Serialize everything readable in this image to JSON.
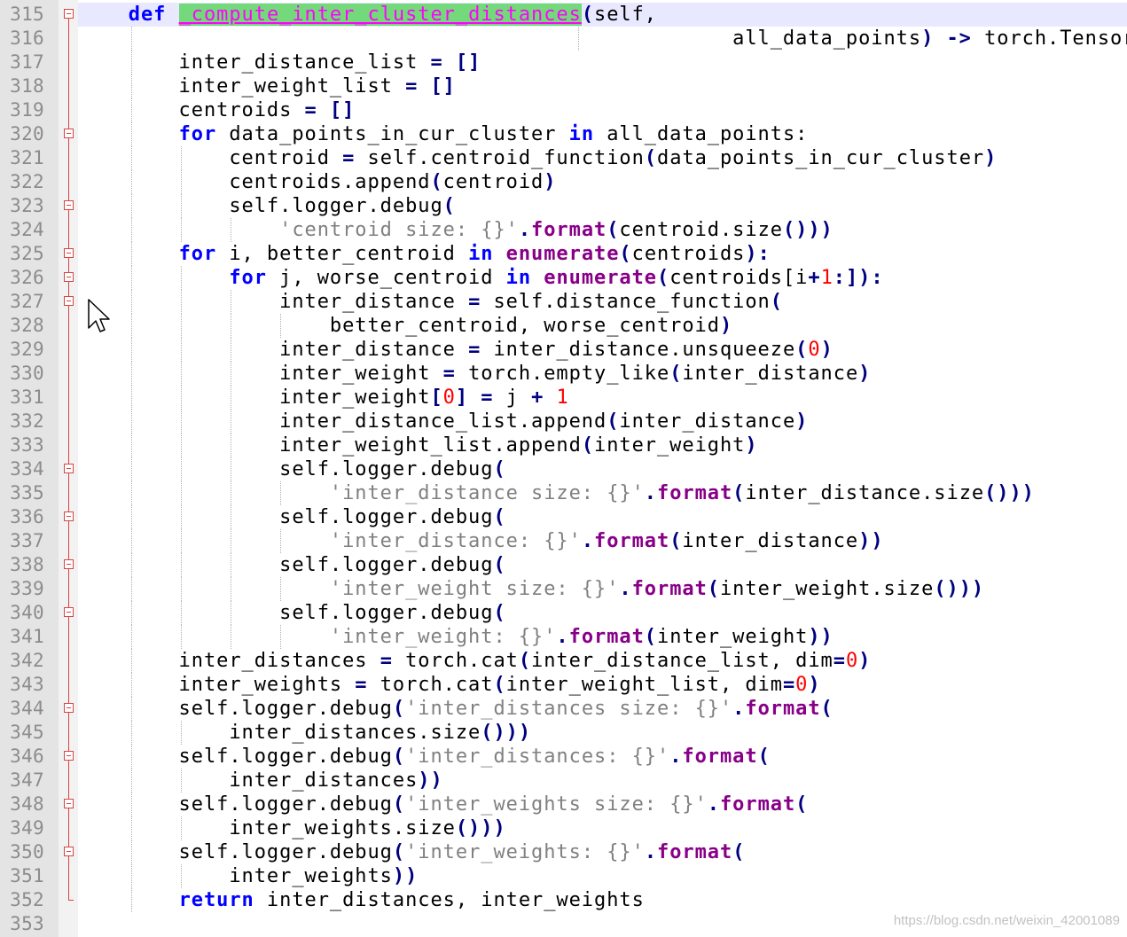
{
  "editor": {
    "lines": [
      {
        "n": "315",
        "fold": "box-first",
        "guides": [],
        "tokens": [
          [
            "",
            "    "
          ],
          [
            "kw",
            "def"
          ],
          [
            "",
            " "
          ],
          [
            "fn-def",
            "_compute_inter_cluster_distances"
          ],
          [
            "op",
            "("
          ],
          [
            "",
            "self,"
          ]
        ],
        "current": true
      },
      {
        "n": "316",
        "fold": "line",
        "guides": [
          148,
          652
        ],
        "tokens": [
          [
            "",
            "                                                    all_data_points"
          ],
          [
            "op",
            ")"
          ],
          [
            "",
            " "
          ],
          [
            "op",
            "->"
          ],
          [
            "",
            " torch.Tensor:"
          ]
        ]
      },
      {
        "n": "317",
        "fold": "line",
        "guides": [
          148
        ],
        "tokens": [
          [
            "",
            "        inter_distance_list "
          ],
          [
            "op",
            "="
          ],
          [
            "",
            " "
          ],
          [
            "op",
            "[]"
          ]
        ]
      },
      {
        "n": "318",
        "fold": "line",
        "guides": [
          148
        ],
        "tokens": [
          [
            "",
            "        inter_weight_list "
          ],
          [
            "op",
            "="
          ],
          [
            "",
            " "
          ],
          [
            "op",
            "[]"
          ]
        ]
      },
      {
        "n": "319",
        "fold": "line",
        "guides": [
          148
        ],
        "tokens": [
          [
            "",
            "        centroids "
          ],
          [
            "op",
            "="
          ],
          [
            "",
            " "
          ],
          [
            "op",
            "[]"
          ]
        ]
      },
      {
        "n": "320",
        "fold": "box",
        "guides": [
          148
        ],
        "tokens": [
          [
            "",
            "        "
          ],
          [
            "kw",
            "for"
          ],
          [
            "",
            " data_points_in_cur_cluster "
          ],
          [
            "kw",
            "in"
          ],
          [
            "",
            " all_data_points:"
          ]
        ]
      },
      {
        "n": "321",
        "fold": "line",
        "guides": [
          148,
          204
        ],
        "tokens": [
          [
            "",
            "            centroid "
          ],
          [
            "op",
            "="
          ],
          [
            "",
            " self.centroid_function"
          ],
          [
            "op",
            "("
          ],
          [
            "",
            "data_points_in_cur_cluster"
          ],
          [
            "op",
            ")"
          ]
        ]
      },
      {
        "n": "322",
        "fold": "line",
        "guides": [
          148,
          204
        ],
        "tokens": [
          [
            "",
            "            centroids.append"
          ],
          [
            "op",
            "("
          ],
          [
            "",
            "centroid"
          ],
          [
            "op",
            ")"
          ]
        ]
      },
      {
        "n": "323",
        "fold": "box",
        "guides": [
          148,
          204
        ],
        "tokens": [
          [
            "",
            "            self.logger.debug"
          ],
          [
            "op",
            "("
          ]
        ]
      },
      {
        "n": "324",
        "fold": "line",
        "guides": [
          148,
          204,
          260
        ],
        "tokens": [
          [
            "",
            "                "
          ],
          [
            "str",
            "'centroid size: {}'"
          ],
          [
            "op",
            "."
          ],
          [
            "builtin",
            "format"
          ],
          [
            "op",
            "("
          ],
          [
            "",
            "centroid.size"
          ],
          [
            "op",
            "()))"
          ]
        ]
      },
      {
        "n": "325",
        "fold": "box",
        "guides": [
          148
        ],
        "tokens": [
          [
            "",
            "        "
          ],
          [
            "kw",
            "for"
          ],
          [
            "",
            " i, better_centroid "
          ],
          [
            "kw",
            "in"
          ],
          [
            "",
            " "
          ],
          [
            "builtin",
            "enumerate"
          ],
          [
            "op",
            "("
          ],
          [
            "",
            "centroids"
          ],
          [
            "op",
            "):"
          ]
        ]
      },
      {
        "n": "326",
        "fold": "box",
        "guides": [
          148,
          204
        ],
        "tokens": [
          [
            "",
            "            "
          ],
          [
            "kw",
            "for"
          ],
          [
            "",
            " j, worse_centroid "
          ],
          [
            "kw",
            "in"
          ],
          [
            "",
            " "
          ],
          [
            "builtin",
            "enumerate"
          ],
          [
            "op",
            "("
          ],
          [
            "",
            "centroids[i"
          ],
          [
            "op",
            "+"
          ],
          [
            "num",
            "1"
          ],
          [
            "op",
            ":]):"
          ]
        ]
      },
      {
        "n": "327",
        "fold": "box",
        "guides": [
          148,
          204,
          260
        ],
        "tokens": [
          [
            "",
            "                inter_distance "
          ],
          [
            "op",
            "="
          ],
          [
            "",
            " self.distance_function"
          ],
          [
            "op",
            "("
          ]
        ]
      },
      {
        "n": "328",
        "fold": "line",
        "guides": [
          148,
          204,
          260,
          316
        ],
        "tokens": [
          [
            "",
            "                    better_centroid, worse_centroid"
          ],
          [
            "op",
            ")"
          ]
        ]
      },
      {
        "n": "329",
        "fold": "line",
        "guides": [
          148,
          204,
          260
        ],
        "tokens": [
          [
            "",
            "                inter_distance "
          ],
          [
            "op",
            "="
          ],
          [
            "",
            " inter_distance.unsqueeze"
          ],
          [
            "op",
            "("
          ],
          [
            "num",
            "0"
          ],
          [
            "op",
            ")"
          ]
        ]
      },
      {
        "n": "330",
        "fold": "line",
        "guides": [
          148,
          204,
          260
        ],
        "tokens": [
          [
            "",
            "                inter_weight "
          ],
          [
            "op",
            "="
          ],
          [
            "",
            " torch.empty_like"
          ],
          [
            "op",
            "("
          ],
          [
            "",
            "inter_distance"
          ],
          [
            "op",
            ")"
          ]
        ]
      },
      {
        "n": "331",
        "fold": "line",
        "guides": [
          148,
          204,
          260
        ],
        "tokens": [
          [
            "",
            "                inter_weight"
          ],
          [
            "op",
            "["
          ],
          [
            "num",
            "0"
          ],
          [
            "op",
            "]"
          ],
          [
            "",
            " "
          ],
          [
            "op",
            "="
          ],
          [
            "",
            " j "
          ],
          [
            "op",
            "+"
          ],
          [
            "",
            " "
          ],
          [
            "num",
            "1"
          ]
        ]
      },
      {
        "n": "332",
        "fold": "line",
        "guides": [
          148,
          204,
          260
        ],
        "tokens": [
          [
            "",
            "                inter_distance_list.append"
          ],
          [
            "op",
            "("
          ],
          [
            "",
            "inter_distance"
          ],
          [
            "op",
            ")"
          ]
        ]
      },
      {
        "n": "333",
        "fold": "line",
        "guides": [
          148,
          204,
          260
        ],
        "tokens": [
          [
            "",
            "                inter_weight_list.append"
          ],
          [
            "op",
            "("
          ],
          [
            "",
            "inter_weight"
          ],
          [
            "op",
            ")"
          ]
        ]
      },
      {
        "n": "334",
        "fold": "box",
        "guides": [
          148,
          204,
          260
        ],
        "tokens": [
          [
            "",
            "                self.logger.debug"
          ],
          [
            "op",
            "("
          ]
        ]
      },
      {
        "n": "335",
        "fold": "line",
        "guides": [
          148,
          204,
          260,
          316
        ],
        "tokens": [
          [
            "",
            "                    "
          ],
          [
            "str",
            "'inter_distance size: {}'"
          ],
          [
            "op",
            "."
          ],
          [
            "builtin",
            "format"
          ],
          [
            "op",
            "("
          ],
          [
            "",
            "inter_distance.size"
          ],
          [
            "op",
            "()))"
          ]
        ]
      },
      {
        "n": "336",
        "fold": "box",
        "guides": [
          148,
          204,
          260
        ],
        "tokens": [
          [
            "",
            "                self.logger.debug"
          ],
          [
            "op",
            "("
          ]
        ]
      },
      {
        "n": "337",
        "fold": "line",
        "guides": [
          148,
          204,
          260,
          316
        ],
        "tokens": [
          [
            "",
            "                    "
          ],
          [
            "str",
            "'inter_distance: {}'"
          ],
          [
            "op",
            "."
          ],
          [
            "builtin",
            "format"
          ],
          [
            "op",
            "("
          ],
          [
            "",
            "inter_distance"
          ],
          [
            "op",
            "))"
          ]
        ]
      },
      {
        "n": "338",
        "fold": "box",
        "guides": [
          148,
          204,
          260
        ],
        "tokens": [
          [
            "",
            "                self.logger.debug"
          ],
          [
            "op",
            "("
          ]
        ]
      },
      {
        "n": "339",
        "fold": "line",
        "guides": [
          148,
          204,
          260,
          316
        ],
        "tokens": [
          [
            "",
            "                    "
          ],
          [
            "str",
            "'inter_weight size: {}'"
          ],
          [
            "op",
            "."
          ],
          [
            "builtin",
            "format"
          ],
          [
            "op",
            "("
          ],
          [
            "",
            "inter_weight.size"
          ],
          [
            "op",
            "()))"
          ]
        ]
      },
      {
        "n": "340",
        "fold": "box",
        "guides": [
          148,
          204,
          260
        ],
        "tokens": [
          [
            "",
            "                self.logger.debug"
          ],
          [
            "op",
            "("
          ]
        ]
      },
      {
        "n": "341",
        "fold": "line",
        "guides": [
          148,
          204,
          260,
          316
        ],
        "tokens": [
          [
            "",
            "                    "
          ],
          [
            "str",
            "'inter_weight: {}'"
          ],
          [
            "op",
            "."
          ],
          [
            "builtin",
            "format"
          ],
          [
            "op",
            "("
          ],
          [
            "",
            "inter_weight"
          ],
          [
            "op",
            "))"
          ]
        ]
      },
      {
        "n": "342",
        "fold": "line",
        "guides": [
          148
        ],
        "tokens": [
          [
            "",
            "        inter_distances "
          ],
          [
            "op",
            "="
          ],
          [
            "",
            " torch.cat"
          ],
          [
            "op",
            "("
          ],
          [
            "",
            "inter_distance_list, dim"
          ],
          [
            "op",
            "="
          ],
          [
            "num",
            "0"
          ],
          [
            "op",
            ")"
          ]
        ]
      },
      {
        "n": "343",
        "fold": "line",
        "guides": [
          148
        ],
        "tokens": [
          [
            "",
            "        inter_weights "
          ],
          [
            "op",
            "="
          ],
          [
            "",
            " torch.cat"
          ],
          [
            "op",
            "("
          ],
          [
            "",
            "inter_weight_list, dim"
          ],
          [
            "op",
            "="
          ],
          [
            "num",
            "0"
          ],
          [
            "op",
            ")"
          ]
        ]
      },
      {
        "n": "344",
        "fold": "box",
        "guides": [
          148
        ],
        "tokens": [
          [
            "",
            "        self.logger.debug"
          ],
          [
            "op",
            "("
          ],
          [
            "str",
            "'inter_distances size: {}'"
          ],
          [
            "op",
            "."
          ],
          [
            "builtin",
            "format"
          ],
          [
            "op",
            "("
          ]
        ]
      },
      {
        "n": "345",
        "fold": "line",
        "guides": [
          148,
          204
        ],
        "tokens": [
          [
            "",
            "            inter_distances.size"
          ],
          [
            "op",
            "()))"
          ]
        ]
      },
      {
        "n": "346",
        "fold": "box",
        "guides": [
          148
        ],
        "tokens": [
          [
            "",
            "        self.logger.debug"
          ],
          [
            "op",
            "("
          ],
          [
            "str",
            "'inter_distances: {}'"
          ],
          [
            "op",
            "."
          ],
          [
            "builtin",
            "format"
          ],
          [
            "op",
            "("
          ]
        ]
      },
      {
        "n": "347",
        "fold": "line",
        "guides": [
          148,
          204
        ],
        "tokens": [
          [
            "",
            "            inter_distances"
          ],
          [
            "op",
            "))"
          ]
        ]
      },
      {
        "n": "348",
        "fold": "box",
        "guides": [
          148
        ],
        "tokens": [
          [
            "",
            "        self.logger.debug"
          ],
          [
            "op",
            "("
          ],
          [
            "str",
            "'inter_weights size: {}'"
          ],
          [
            "op",
            "."
          ],
          [
            "builtin",
            "format"
          ],
          [
            "op",
            "("
          ]
        ]
      },
      {
        "n": "349",
        "fold": "line",
        "guides": [
          148,
          204
        ],
        "tokens": [
          [
            "",
            "            inter_weights.size"
          ],
          [
            "op",
            "()))"
          ]
        ]
      },
      {
        "n": "350",
        "fold": "box",
        "guides": [
          148
        ],
        "tokens": [
          [
            "",
            "        self.logger.debug"
          ],
          [
            "op",
            "("
          ],
          [
            "str",
            "'inter_weights: {}'"
          ],
          [
            "op",
            "."
          ],
          [
            "builtin",
            "format"
          ],
          [
            "op",
            "("
          ]
        ]
      },
      {
        "n": "351",
        "fold": "line",
        "guides": [
          148,
          204
        ],
        "tokens": [
          [
            "",
            "            inter_weights"
          ],
          [
            "op",
            "))"
          ]
        ]
      },
      {
        "n": "352",
        "fold": "last",
        "guides": [
          148
        ],
        "tokens": [
          [
            "",
            "        "
          ],
          [
            "kw",
            "return"
          ],
          [
            "",
            " inter_distances, inter_weights"
          ]
        ]
      },
      {
        "n": "353",
        "fold": "none",
        "guides": [],
        "tokens": []
      }
    ]
  },
  "watermark": "https://blog.csdn.net/weixin_42001089",
  "colors": {
    "keyword": "#0000ff",
    "operator": "#000080",
    "string": "#808080",
    "number": "#ff0000",
    "builtin": "#880088",
    "function_def_highlight": "#74d97a",
    "fold_marker": "#d84444"
  },
  "icons": {
    "cursor": "mouse-pointer-icon"
  }
}
